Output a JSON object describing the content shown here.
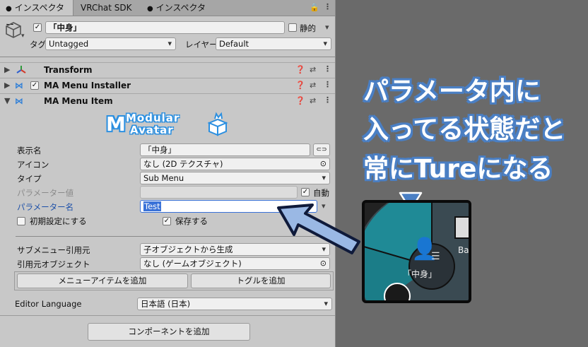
{
  "tabs": [
    {
      "label": "インスペクター",
      "icon": "info-icon"
    },
    {
      "label": "VRChat SDK"
    },
    {
      "label": "インスペクター",
      "icon": "info-icon"
    }
  ],
  "object": {
    "name": "「中身」",
    "static_label": "静的",
    "tag_label": "タグ",
    "tag_value": "Untagged",
    "layer_label": "レイヤー",
    "layer_value": "Default"
  },
  "components": [
    {
      "name": "Transform"
    },
    {
      "name": "MA Menu Installer"
    },
    {
      "name": "MA Menu Item"
    }
  ],
  "logo": {
    "line1": "Modular",
    "line2": "Avatar"
  },
  "menu_item": {
    "display_name_label": "表示名",
    "display_name_value": "「中身」",
    "icon_label": "アイコン",
    "icon_value": "なし (2D テクスチャ)",
    "type_label": "タイプ",
    "type_value": "Sub Menu",
    "param_value_label": "パラメーター値",
    "auto_label": "自動",
    "param_name_label": "パラメーター名",
    "param_name_value": "Test",
    "initial_label": "初期設定にする",
    "save_label": "保存する",
    "sub_menu_source_label": "サブメニュー引用元",
    "sub_menu_source_value": "子オブジェクトから生成",
    "source_object_label": "引用元オブジェクト",
    "source_object_value": "なし (ゲームオブジェクト)",
    "add_menu_item_button": "メニューアイテムを追加",
    "add_toggle_button": "トグルを追加",
    "editor_language_label": "Editor Language",
    "editor_language_value": "日本語 (日本)",
    "add_component_button": "コンポーネントを追加"
  },
  "callout": {
    "line1": "パラメータ内に",
    "line2": "入ってる状態だと",
    "line3": "常にTureになる"
  },
  "radial": {
    "label": "「中身」",
    "side_label": "Ba"
  },
  "colors": {
    "accent": "#4a7fc4",
    "radial": "#1f8a96"
  }
}
